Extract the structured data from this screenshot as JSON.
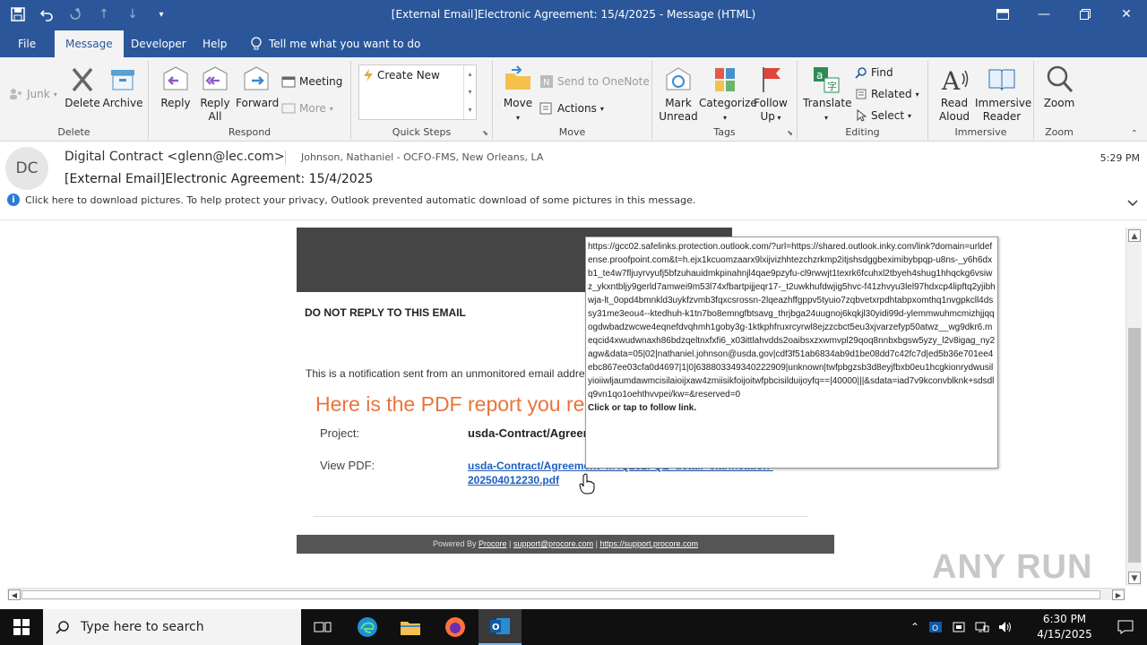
{
  "window": {
    "title": "[External Email]Electronic Agreement: 15/4/2025  -  Message (HTML)"
  },
  "tabs": [
    {
      "label": "File"
    },
    {
      "label": "Message"
    },
    {
      "label": "Developer"
    },
    {
      "label": "Help"
    }
  ],
  "tell_me": "Tell me what you want to do",
  "ribbon": {
    "delete_group": {
      "junk": "Junk",
      "delete": "Delete",
      "archive": "Archive",
      "label": "Delete"
    },
    "respond_group": {
      "reply": "Reply",
      "reply_all_1": "Reply",
      "reply_all_2": "All",
      "forward": "Forward",
      "meeting": "Meeting",
      "more": "More",
      "label": "Respond"
    },
    "quick_steps": {
      "create_new": "Create New",
      "label": "Quick Steps"
    },
    "move_group": {
      "move": "Move",
      "onenote": "Send to OneNote",
      "actions": "Actions",
      "label": "Move"
    },
    "tags_group": {
      "mark_1": "Mark",
      "mark_2": "Unread",
      "categorize": "Categorize",
      "follow_1": "Follow",
      "follow_2": "Up",
      "label": "Tags"
    },
    "editing_group": {
      "translate": "Translate",
      "find": "Find",
      "related": "Related",
      "select": "Select",
      "label": "Editing"
    },
    "immersive_group": {
      "read_1": "Read",
      "read_2": "Aloud",
      "reader_1": "Immersive",
      "reader_2": "Reader",
      "label": "Immersive"
    },
    "zoom_group": {
      "zoom": "Zoom",
      "label": "Zoom"
    }
  },
  "message": {
    "avatar": "DC",
    "sender": "Digital Contract <glenn@lec.com>",
    "recipient": "Johnson, Nathaniel - OCFO-FMS, New Orleans, LA",
    "time": "5:29 PM",
    "subject": "[External Email]Electronic Agreement: 15/4/2025",
    "info": "Click here to download pictures. To help protect your privacy, Outlook prevented automatic download of some pictures in this message."
  },
  "email_body": {
    "do_not_reply": "DO NOT REPLY TO THIS EMAIL",
    "notice": "This is a notification sent from an unmonitored email addre",
    "heading": "Here is the PDF report you re",
    "project_label": "Project:",
    "project_value": "usda-Contract/Agreem",
    "view_pdf_label": "View PDF:",
    "pdf_link": "usda-Contract/Agreement_M4Q232FQE_detail_clarification-202504012230.pdf",
    "footer_prefix": "Powered By",
    "footer_procore": "Procore",
    "footer_sep1": "|",
    "footer_email": "support@procore.com",
    "footer_sep2": "|",
    "footer_site": "https://support.procore.com"
  },
  "tooltip": {
    "url": "https://gcc02.safelinks.protection.outlook.com/?url=https://shared.outlook.inky.com/link?domain=urldefense.proofpoint.com&t=h.ejx1kcuomzaarx9lxijvizhhtezchzrkmp2itjshsdggbeximibybpqp-u8ns-_y6h6dxb1_te4w7fljuyrvyufj5bfzuhauidmkpinahnjl4qae9pzyfu-cl9rwwjt1texrk6fcuhxl2tbyeh4shug1hhqckg6vsiwz_ykxntbljy9gerld7amwei9m53l74xfbartpijjeqr17-_t2uwkhufdwjig5hvc-f41zhvyu3lel97hdxcp4lipftq2yjibhwja-lt_0opd4bmnkld3uykfzvmb3fqxcsrossn-2lqeazhffgppv5tyuio7zqbvetxrpdhtabpxomthq1nvgpkcll4dssy31me3eou4--ktedhuh-k1tn7bo8emngfbtsavg_thrjbga24uugnoj6kqkjl30yidi99d-ylemmwuhmcmizhjjqqogdwbadzwcwe4eqnefdvqhmh1goby3g-1ktkphfruxrcyrwl8ejzzcbct5eu3xjvarzefyp50atwz__wg9dkr6.meqcid4xwudwnaxh86bdzqeltnxfxfi6_x03ittlahvdds2oaibsxzxwmvpl29qoq8nnbxbgsw5yzy_l2v8igag_ny2agw&data=05|02|nathaniel.johnson@usda.gov|cdf3f51ab6834ab9d1be08dd7c42fc7d|ed5b36e701ee4ebc867ee03cfa0d4697|1|0|638803349340222909|unknown|twfpbgzsb3d8eyjfbxb0eu1hcgkionrydwusilyioiiwljaumdawmcisilaioijxaw4zmiisikfoijoitwfpbcisilduijoyfq==|40000|||&sdata=iad7v9kconvblknk+sdsdlq9vn1qo1oehthvvpei/kw=&reserved=0",
    "follow": "Click or tap to follow link."
  },
  "watermark": "ANY RUN",
  "taskbar": {
    "search_placeholder": "Type here to search",
    "time": "6:30 PM",
    "date": "4/15/2025"
  },
  "colors": {
    "accent": "#2b579a",
    "heading_orange": "#e8743b",
    "link_blue": "#1f5fbf"
  }
}
